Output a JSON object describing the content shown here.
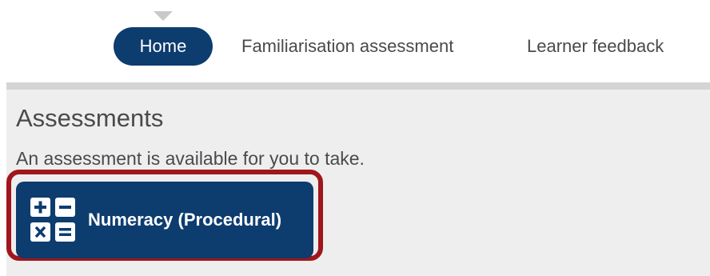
{
  "nav": {
    "items": [
      {
        "label": "Home",
        "active": true
      },
      {
        "label": "Familiarisation assessment",
        "active": false
      },
      {
        "label": "Learner feedback",
        "active": false
      }
    ]
  },
  "assessments": {
    "title": "Assessments",
    "message": "An assessment is available for you to take.",
    "available": [
      {
        "label": "Numeracy (Procedural)",
        "icon": "calculator-icon"
      }
    ]
  },
  "colors": {
    "brand_navy": "#0d3c6f",
    "highlight_red": "#a0161d",
    "panel_bg": "#eeeeee",
    "text_gray": "#4a4a4a"
  }
}
